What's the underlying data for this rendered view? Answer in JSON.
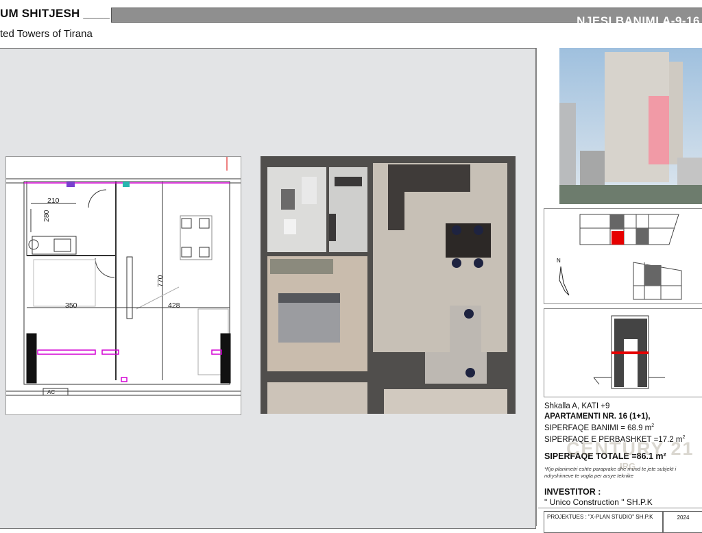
{
  "header": {
    "title": "UM SHITJESH ____",
    "subtitle": "ted  Towers of Tirana",
    "unit_label": "NJESI BANIMI A-9-16"
  },
  "floorplan_2d": {
    "dimensions": [
      "210",
      "280",
      "350",
      "770",
      "428"
    ],
    "label_bottom": "AC"
  },
  "specs": {
    "staircase": "Shkalla A, KATI +9",
    "apartment": "APARTAMENTI NR. 16 (1+1),",
    "area_living": "SIPERFAQE BANIMI = 68.9 m",
    "area_common": "SIPERFAQE E PERBASHKET =17.2 m",
    "area_total": "SIPERFAQE TOTALE =86.1 m²",
    "note": "*Kjo planimetri eshte paraprake dhe mund te jete subjekt i ndryshimeve te vogla per arsye teknike"
  },
  "watermark": {
    "brand": "CENTURY 21",
    "sub": "IRG"
  },
  "investor": {
    "label": "INVESTITOR :",
    "name": "\" Unico Construction \" SH.P.K"
  },
  "footer": {
    "project": "PROJEKTUES : \"X-PLAN STUDIO\" SH.P.K",
    "year": "2024"
  },
  "key_plan": {
    "north_label": "N"
  },
  "colors": {
    "highlight": "#e60000",
    "header_bar": "#8f8f8f"
  }
}
